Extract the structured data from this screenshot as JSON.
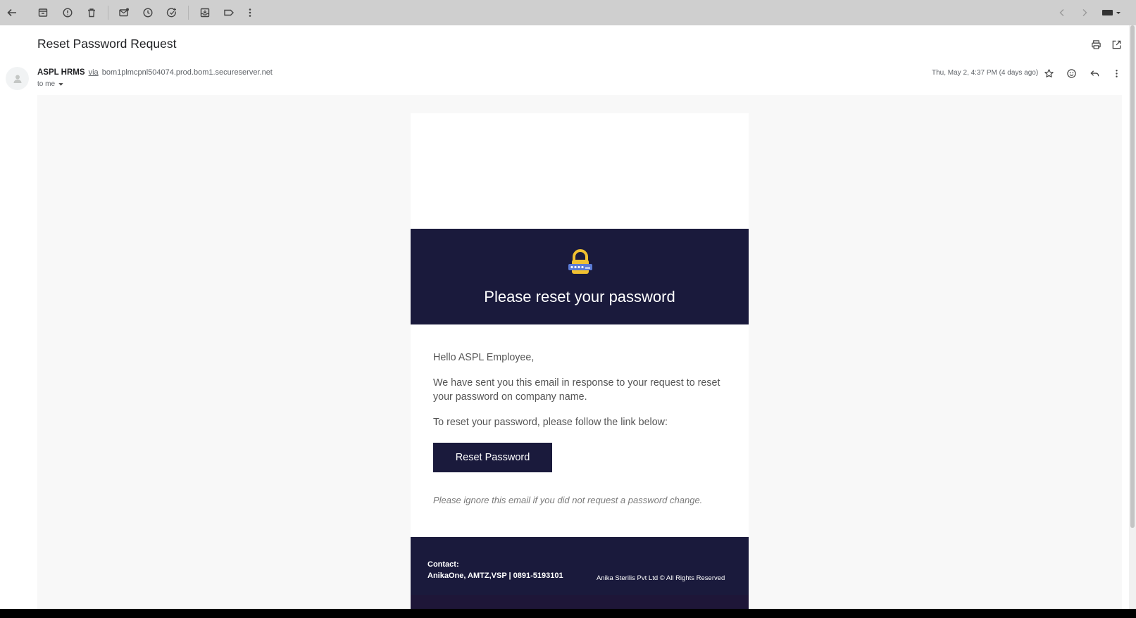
{
  "toolbar": {
    "icons": [
      "back-icon",
      "archive-icon",
      "report-spam-icon",
      "delete-icon",
      "mark-unread-icon",
      "snooze-icon",
      "add-task-icon",
      "move-to-icon",
      "label-icon",
      "more-icon",
      "newer-icon",
      "older-icon",
      "input-tools-icon"
    ]
  },
  "email": {
    "subject": "Reset Password Request",
    "sender_name": "ASPL HRMS",
    "via_label": "via",
    "via_domain": "bom1plmcpnl504074.prod.bom1.secureserver.net",
    "to_label": "to me",
    "date": "Thu, May 2, 4:37 PM (4 days ago)"
  },
  "message": {
    "hero_title": "Please reset your password",
    "greeting": "Hello ASPL Employee,",
    "paragraph1": "We have sent you this email in response to your request to reset your password on company name.",
    "paragraph2": "To reset your password, please follow the link below:",
    "button_label": "Reset Password",
    "ignore_note": "Please ignore this email if you did not request a password change."
  },
  "footer": {
    "contact_label": "Contact:",
    "contact_text": "AnikaOne, AMTZ,VSP | 0891-5193101",
    "copyright": "Anika Sterilis Pvt Ltd © All Rights Reserved"
  },
  "colors": {
    "brand_dark": "#1a1a3c",
    "toolbar_bg": "#cfcfcf",
    "panel_bg": "#f8f8f8"
  }
}
